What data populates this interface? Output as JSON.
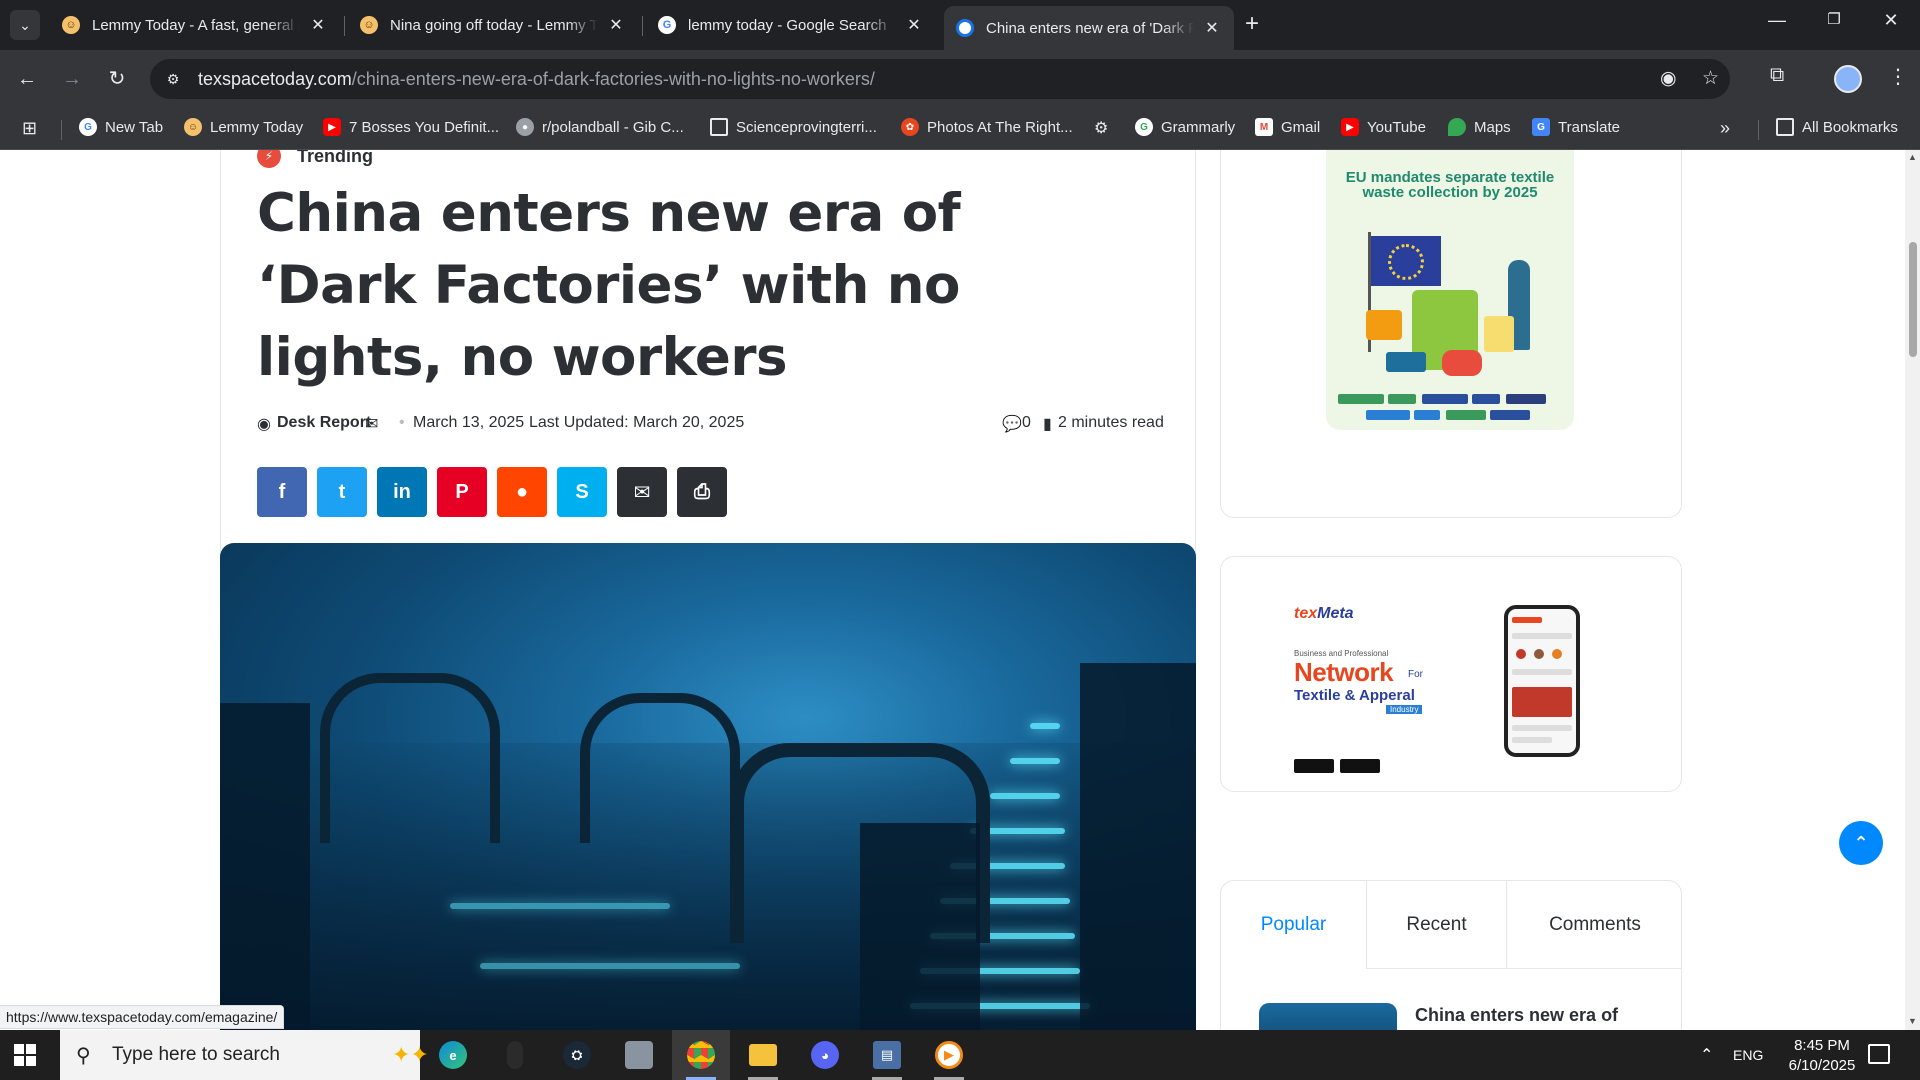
{
  "browser": {
    "tabs": [
      {
        "title": "Lemmy Today - A fast, general p",
        "favicon": "lemmy-icon",
        "active": false
      },
      {
        "title": "Nina going off today - Lemmy T",
        "favicon": "lemmy-icon",
        "active": false
      },
      {
        "title": "lemmy today - Google Search",
        "favicon": "google-icon",
        "active": false
      },
      {
        "title": "China enters new era of 'Dark Fa",
        "favicon": "texspace-icon",
        "active": true
      }
    ],
    "url_host": "texspacetoday.com",
    "url_path": "/china-enters-new-era-of-dark-factories-with-no-lights-no-workers/",
    "bookmarks": [
      {
        "label": "New Tab",
        "icon": "google-icon",
        "color": "#4285f4"
      },
      {
        "label": "Lemmy Today",
        "icon": "lemmy-icon",
        "color": "#f5c06b"
      },
      {
        "label": "7 Bosses You Definit...",
        "icon": "youtube-icon",
        "color": "#ff0000"
      },
      {
        "label": "r/polandball - Gib C...",
        "icon": "reddit-icon",
        "color": "#9aa0a6"
      },
      {
        "label": "Scienceprovingterri...",
        "icon": "folder-icon",
        "color": "#35363a"
      },
      {
        "label": "Photos At The Right...",
        "icon": "photos-icon",
        "color": "#e8461e"
      },
      {
        "label": "Grammarly",
        "icon": "google-icon",
        "color": "#34a853"
      },
      {
        "label": "Gmail",
        "icon": "gmail-icon",
        "color": "#ea4335"
      },
      {
        "label": "YouTube",
        "icon": "youtube-icon",
        "color": "#ff0000"
      },
      {
        "label": "Maps",
        "icon": "maps-icon",
        "color": "#34a853"
      },
      {
        "label": "Translate",
        "icon": "translate-icon",
        "color": "#4285f4"
      }
    ],
    "all_bookmarks": "All Bookmarks",
    "status_url": "https://www.texspacetoday.com/emagazine/"
  },
  "article": {
    "category": "Trending",
    "title": "China enters new era of ‘Dark Factories’ with no lights, no workers",
    "author": "Desk Report",
    "date": "March 13, 2025",
    "updated": "Last Updated: March 20, 2025",
    "comments": "0",
    "read_time": "2 minutes read",
    "share": [
      {
        "name": "facebook",
        "glyph": "f",
        "color": "#4267b2"
      },
      {
        "name": "twitter",
        "glyph": "t",
        "color": "#1da1f2"
      },
      {
        "name": "linkedin",
        "glyph": "in",
        "color": "#0077b5"
      },
      {
        "name": "pinterest",
        "glyph": "P",
        "color": "#e60023"
      },
      {
        "name": "reddit",
        "glyph": "r",
        "color": "#ff4500"
      },
      {
        "name": "skype",
        "glyph": "S",
        "color": "#00aff0"
      },
      {
        "name": "email",
        "glyph": "✉",
        "color": "#2c2f34"
      },
      {
        "name": "print",
        "glyph": "⎙",
        "color": "#2c2f34"
      }
    ]
  },
  "sidebar": {
    "eu_ad_title": "EU mandates separate textile waste collection by 2025",
    "texmeta": {
      "logo_tex": "tex",
      "logo_meta": "Meta",
      "tagline": "Business and Professional",
      "network": "Network",
      "for": "For",
      "textile": "Textile & Apperal",
      "industry": "Industry"
    },
    "tabs": [
      "Popular",
      "Recent",
      "Comments"
    ],
    "popular_first_title": "China enters new era of"
  },
  "taskbar": {
    "search_placeholder": "Type here to search",
    "language": "ENG",
    "time": "8:45 PM",
    "date": "6/10/2025"
  },
  "colors": {
    "accent": "#0088ff",
    "trending": "#e74c3c"
  }
}
